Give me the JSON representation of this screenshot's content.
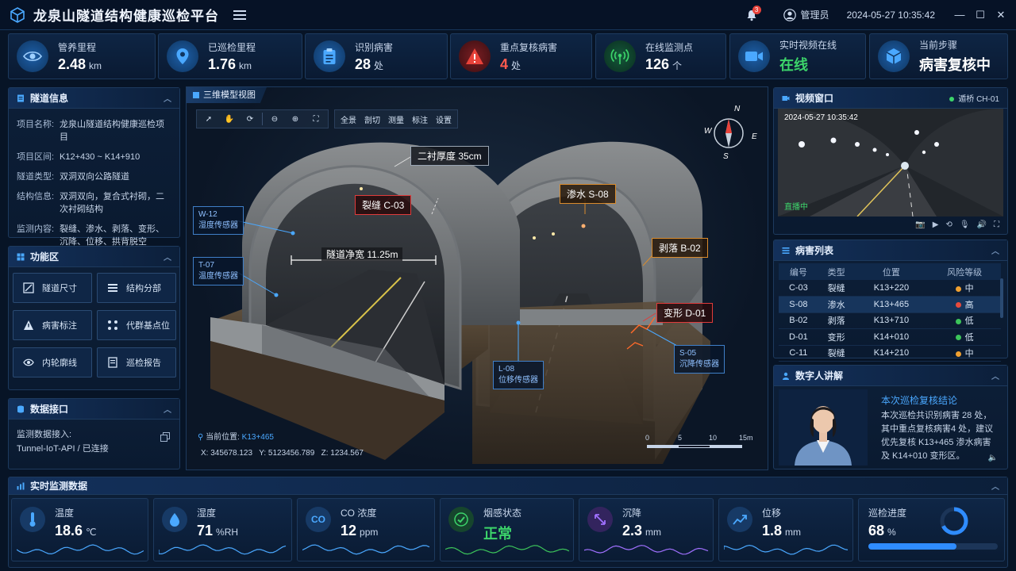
{
  "header": {
    "title": "龙泉山隧道结构健康巡检平台",
    "notif_count": "3",
    "user": "管理员",
    "datetime": "2024-05-27 10:35:42"
  },
  "stats": [
    {
      "label": "管养里程",
      "value": "2.48",
      "unit": "km",
      "icon": "eye-icon"
    },
    {
      "label": "已巡检里程",
      "value": "1.76",
      "unit": "km",
      "icon": "location-pin-icon"
    },
    {
      "label": "识别病害",
      "value": "28",
      "unit": "处",
      "icon": "clipboard-icon"
    },
    {
      "label": "重点复核病害",
      "value": "4",
      "unit": "处",
      "icon": "warning-icon"
    },
    {
      "label": "在线监测点",
      "value": "126",
      "unit": "个",
      "icon": "signal-icon"
    },
    {
      "label": "实时视频在线",
      "value": "在线",
      "unit": "",
      "icon": "camera-icon"
    },
    {
      "label": "当前步骤",
      "value": "病害复核中",
      "unit": "",
      "icon": "cube-icon"
    }
  ],
  "tunnel_info": {
    "title": "隧道信息",
    "rows": [
      {
        "k": "项目名称:",
        "v": "龙泉山隧道结构健康巡检项目"
      },
      {
        "k": "项目区间:",
        "v": "K12+430 ~ K14+910"
      },
      {
        "k": "隧道类型:",
        "v": "双洞双向公路隧道"
      },
      {
        "k": "结构信息:",
        "v": "双洞双向，复合式衬砌，二次衬砌结构"
      },
      {
        "k": "监测内容:",
        "v": "裂缝、渗水、剥落、变形、沉降、位移、拱背脱空"
      }
    ]
  },
  "functions": {
    "title": "功能区",
    "items": [
      "隧道尺寸",
      "结构分部",
      "病害标注",
      "代群基点位",
      "内轮廓线",
      "巡检报告"
    ]
  },
  "data_api": {
    "title": "数据接口",
    "line1": "监测数据接入:",
    "line2": "Tunnel-IoT-API / 已连接"
  },
  "viewer": {
    "title": "三维模型视图",
    "tools": [
      "全景",
      "剖切",
      "测量",
      "标注",
      "设置"
    ],
    "compass": {
      "n": "N",
      "e": "E",
      "s": "S",
      "w": "W"
    },
    "annotations": {
      "thickness": "二衬厚度  35cm",
      "crack": "裂缝  C-03",
      "seep": "渗水  S-08",
      "spall": "剥落  B-02",
      "deform": "变形  D-01",
      "width": "隧道净宽  11.25m"
    },
    "sensors": {
      "w12_id": "W-12",
      "w12_name": "湿度传感器",
      "t07_id": "T-07",
      "t07_name": "温度传感器",
      "l08_id": "L-08",
      "l08_name": "位移传感器",
      "s05_id": "S-05",
      "s05_name": "沉降传感器"
    },
    "position_label": "当前位置:",
    "position": "K13+465",
    "coords": "X: 345678.123   Y: 5123456.789   Z: 1234.567",
    "scale": [
      "0",
      "5",
      "10",
      "15m"
    ]
  },
  "video": {
    "title": "视频窗口",
    "status": "遁桥 CH-01",
    "timestamp": "2024-05-27  10:35:42",
    "live": "直播中"
  },
  "defects": {
    "title": "病害列表",
    "headers": [
      "编号",
      "类型",
      "位置",
      "风险等级"
    ],
    "rows": [
      {
        "id": "C-03",
        "type": "裂缝",
        "pos": "K13+220",
        "risk": "中",
        "color": "#f0a030"
      },
      {
        "id": "S-08",
        "type": "渗水",
        "pos": "K13+465",
        "risk": "高",
        "color": "#e84a3c"
      },
      {
        "id": "B-02",
        "type": "剥落",
        "pos": "K13+710",
        "risk": "低",
        "color": "#3cc45a"
      },
      {
        "id": "D-01",
        "type": "变形",
        "pos": "K14+010",
        "risk": "低",
        "color": "#3cc45a"
      },
      {
        "id": "C-11",
        "type": "裂缝",
        "pos": "K14+210",
        "risk": "中",
        "color": "#f0a030"
      }
    ]
  },
  "digital_human": {
    "title": "数字人讲解",
    "heading": "本次巡检复核结论",
    "body": "本次巡检共识别病害 28 处，其中重点复核病害4 处，建议优先复核 K13+465 渗水病害及 K14+010 变形区。"
  },
  "monitor": {
    "title": "实时监测数据",
    "cards": [
      {
        "label": "温度",
        "value": "18.6",
        "unit": "℃",
        "color": "#4aa8ff"
      },
      {
        "label": "湿度",
        "value": "71",
        "unit": "%RH",
        "color": "#4aa8ff"
      },
      {
        "label": "CO 浓度",
        "value": "12",
        "unit": "ppm",
        "icon_text": "CO",
        "color": "#4aa8ff"
      },
      {
        "label": "烟感状态",
        "value": "正常",
        "unit": "",
        "color": "#3cc45a"
      },
      {
        "label": "沉降",
        "value": "2.3",
        "unit": "mm",
        "color": "#a070ff"
      },
      {
        "label": "位移",
        "value": "1.8",
        "unit": "mm",
        "color": "#4aa8ff"
      },
      {
        "label": "巡检进度",
        "value": "68",
        "unit": "%",
        "progress": 0.68,
        "color": "#2f8cff"
      }
    ]
  }
}
